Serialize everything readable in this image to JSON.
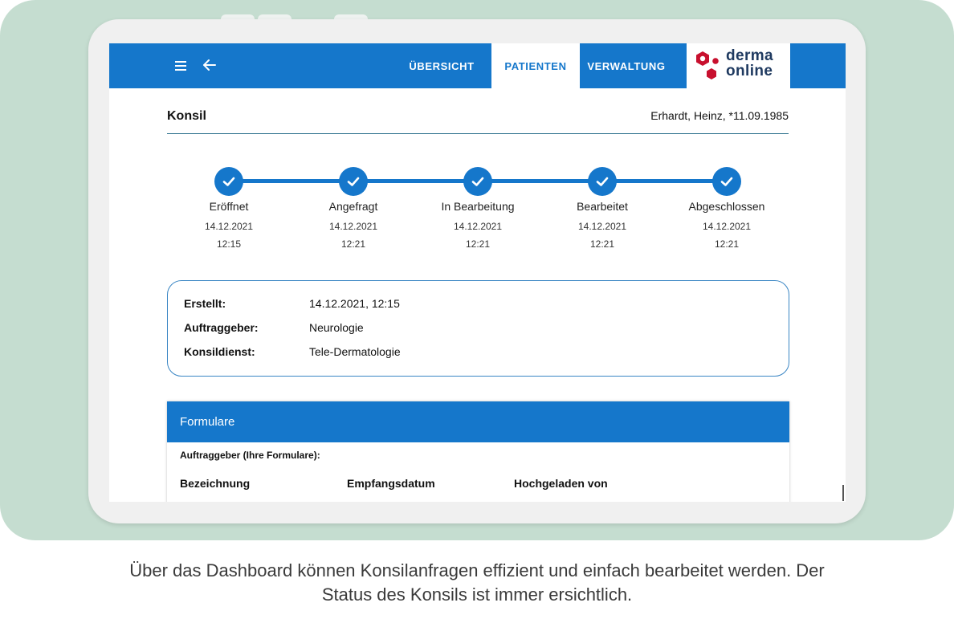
{
  "topbar": {
    "nav": [
      {
        "label": "ÜBERSICHT",
        "active": false
      },
      {
        "label": "PATIENTEN",
        "active": true
      },
      {
        "label": "VERWALTUNG",
        "active": false
      }
    ],
    "logo": {
      "line1": "derma",
      "line2": "online",
      "dot_color": "#c8102e",
      "text_color": "#1f3a60"
    },
    "menu_icon": "hamburger-menu-icon",
    "back_icon": "arrow-left-icon"
  },
  "header": {
    "title": "Konsil",
    "patient": "Erhardt, Heinz, *11.09.1985"
  },
  "steps": [
    {
      "label": "Eröffnet",
      "date": "14.12.2021",
      "time": "12:15"
    },
    {
      "label": "Angefragt",
      "date": "14.12.2021",
      "time": "12:21"
    },
    {
      "label": "In Bearbeitung",
      "date": "14.12.2021",
      "time": "12:21"
    },
    {
      "label": "Bearbeitet",
      "date": "14.12.2021",
      "time": "12:21"
    },
    {
      "label": "Abgeschlossen",
      "date": "14.12.2021",
      "time": "12:21"
    }
  ],
  "info": [
    {
      "label": "Erstellt:",
      "value": "14.12.2021, 12:15"
    },
    {
      "label": "Auftraggeber:",
      "value": "Neurologie"
    },
    {
      "label": "Konsildienst:",
      "value": "Tele-Dermatologie"
    }
  ],
  "formulare": {
    "title": "Formulare",
    "subtitle": "Auftraggeber (Ihre Formulare):",
    "columns": [
      "Bezeichnung",
      "Empfangsdatum",
      "Hochgeladen von"
    ]
  },
  "caption": {
    "line1": "Über das Dashboard können Konsilanfragen effizient und einfach bearbeitet werden. Der",
    "line2": "Status des Konsils ist immer ersichtlich."
  },
  "colors": {
    "primary": "#1577cb",
    "background_panel": "#c5ddd0"
  }
}
